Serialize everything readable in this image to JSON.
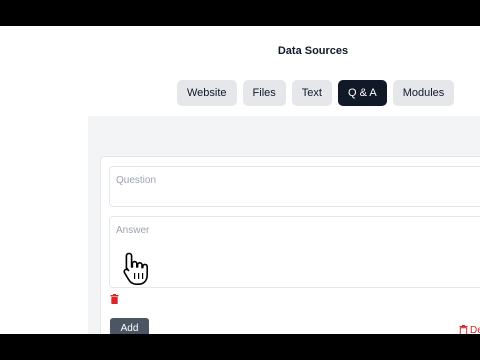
{
  "page_title": "Data Sources",
  "tabs": [
    {
      "label": "Website",
      "active": false
    },
    {
      "label": "Files",
      "active": false
    },
    {
      "label": "Text",
      "active": false
    },
    {
      "label": "Q & A",
      "active": true
    },
    {
      "label": "Modules",
      "active": false
    }
  ],
  "qa_form": {
    "question_placeholder": "Question",
    "answer_placeholder": "Answer",
    "add_label": "Add",
    "delete_label": "De"
  },
  "colors": {
    "active_tab": "#111827",
    "tab": "#e5e7eb",
    "danger": "#dc2626",
    "add_button": "#4b5563"
  },
  "icons": {
    "delete": "trash-icon",
    "cursor": "hand-pointer-icon"
  }
}
